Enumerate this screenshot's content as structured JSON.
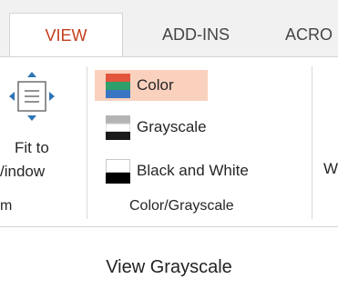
{
  "tabs": [
    {
      "label": "VIEW",
      "active": true
    },
    {
      "label": "ADD-INS",
      "active": false
    },
    {
      "label": "ACRO",
      "active": false
    }
  ],
  "ribbon": {
    "fit_to_window": {
      "line1": "Fit to",
      "line2": "/indow",
      "icon": "fit-to-window-icon"
    },
    "left_group_label": "m",
    "color_grayscale": {
      "items": [
        {
          "label": "Color",
          "icon": "color-swatch-icon",
          "selected": true
        },
        {
          "label": "Grayscale",
          "icon": "grayscale-swatch-icon",
          "selected": false
        },
        {
          "label": "Black and White",
          "icon": "black-and-white-swatch-icon",
          "selected": false
        }
      ],
      "group_label": "Color/Grayscale"
    },
    "right_cut_text": "W"
  },
  "caption": "View Grayscale",
  "colors": {
    "accent": "#c43e1c",
    "selected_bg": "#fad1bd",
    "tabbar_bg": "#f1f1f1",
    "border": "#d4d4d4"
  }
}
